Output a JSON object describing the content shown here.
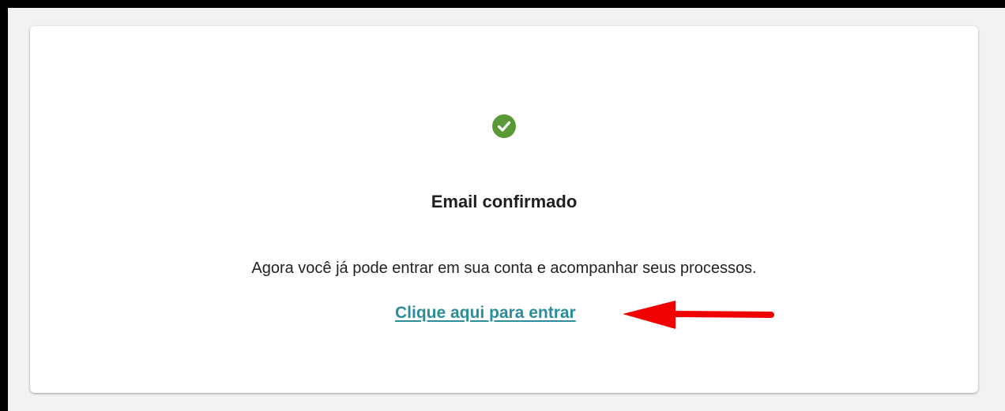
{
  "confirmation": {
    "icon": "check-circle-icon",
    "icon_color": "#5a9a36",
    "title": "Email confirmado",
    "message": "Agora você já pode entrar em sua conta e acompanhar seus processos.",
    "login_link": "Clique aqui para entrar",
    "link_color": "#2a8d99"
  },
  "annotation": {
    "icon": "red-arrow-icon",
    "color": "#f00000"
  }
}
